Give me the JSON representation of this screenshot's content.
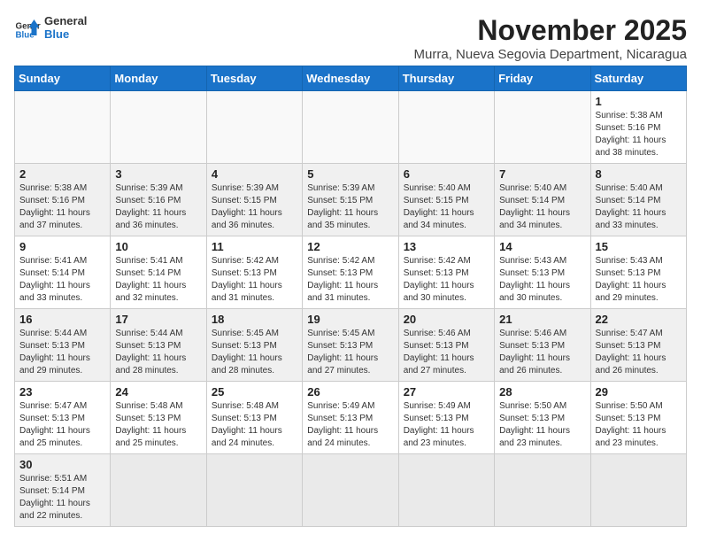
{
  "header": {
    "logo_line1": "General",
    "logo_line2": "Blue",
    "month_title": "November 2025",
    "subtitle": "Murra, Nueva Segovia Department, Nicaragua"
  },
  "weekdays": [
    "Sunday",
    "Monday",
    "Tuesday",
    "Wednesday",
    "Thursday",
    "Friday",
    "Saturday"
  ],
  "weeks": [
    [
      {
        "day": "",
        "info": ""
      },
      {
        "day": "",
        "info": ""
      },
      {
        "day": "",
        "info": ""
      },
      {
        "day": "",
        "info": ""
      },
      {
        "day": "",
        "info": ""
      },
      {
        "day": "",
        "info": ""
      },
      {
        "day": "1",
        "info": "Sunrise: 5:38 AM\nSunset: 5:16 PM\nDaylight: 11 hours and 38 minutes."
      }
    ],
    [
      {
        "day": "2",
        "info": "Sunrise: 5:38 AM\nSunset: 5:16 PM\nDaylight: 11 hours and 37 minutes."
      },
      {
        "day": "3",
        "info": "Sunrise: 5:39 AM\nSunset: 5:16 PM\nDaylight: 11 hours and 36 minutes."
      },
      {
        "day": "4",
        "info": "Sunrise: 5:39 AM\nSunset: 5:15 PM\nDaylight: 11 hours and 36 minutes."
      },
      {
        "day": "5",
        "info": "Sunrise: 5:39 AM\nSunset: 5:15 PM\nDaylight: 11 hours and 35 minutes."
      },
      {
        "day": "6",
        "info": "Sunrise: 5:40 AM\nSunset: 5:15 PM\nDaylight: 11 hours and 34 minutes."
      },
      {
        "day": "7",
        "info": "Sunrise: 5:40 AM\nSunset: 5:14 PM\nDaylight: 11 hours and 34 minutes."
      },
      {
        "day": "8",
        "info": "Sunrise: 5:40 AM\nSunset: 5:14 PM\nDaylight: 11 hours and 33 minutes."
      }
    ],
    [
      {
        "day": "9",
        "info": "Sunrise: 5:41 AM\nSunset: 5:14 PM\nDaylight: 11 hours and 33 minutes."
      },
      {
        "day": "10",
        "info": "Sunrise: 5:41 AM\nSunset: 5:14 PM\nDaylight: 11 hours and 32 minutes."
      },
      {
        "day": "11",
        "info": "Sunrise: 5:42 AM\nSunset: 5:13 PM\nDaylight: 11 hours and 31 minutes."
      },
      {
        "day": "12",
        "info": "Sunrise: 5:42 AM\nSunset: 5:13 PM\nDaylight: 11 hours and 31 minutes."
      },
      {
        "day": "13",
        "info": "Sunrise: 5:42 AM\nSunset: 5:13 PM\nDaylight: 11 hours and 30 minutes."
      },
      {
        "day": "14",
        "info": "Sunrise: 5:43 AM\nSunset: 5:13 PM\nDaylight: 11 hours and 30 minutes."
      },
      {
        "day": "15",
        "info": "Sunrise: 5:43 AM\nSunset: 5:13 PM\nDaylight: 11 hours and 29 minutes."
      }
    ],
    [
      {
        "day": "16",
        "info": "Sunrise: 5:44 AM\nSunset: 5:13 PM\nDaylight: 11 hours and 29 minutes."
      },
      {
        "day": "17",
        "info": "Sunrise: 5:44 AM\nSunset: 5:13 PM\nDaylight: 11 hours and 28 minutes."
      },
      {
        "day": "18",
        "info": "Sunrise: 5:45 AM\nSunset: 5:13 PM\nDaylight: 11 hours and 28 minutes."
      },
      {
        "day": "19",
        "info": "Sunrise: 5:45 AM\nSunset: 5:13 PM\nDaylight: 11 hours and 27 minutes."
      },
      {
        "day": "20",
        "info": "Sunrise: 5:46 AM\nSunset: 5:13 PM\nDaylight: 11 hours and 27 minutes."
      },
      {
        "day": "21",
        "info": "Sunrise: 5:46 AM\nSunset: 5:13 PM\nDaylight: 11 hours and 26 minutes."
      },
      {
        "day": "22",
        "info": "Sunrise: 5:47 AM\nSunset: 5:13 PM\nDaylight: 11 hours and 26 minutes."
      }
    ],
    [
      {
        "day": "23",
        "info": "Sunrise: 5:47 AM\nSunset: 5:13 PM\nDaylight: 11 hours and 25 minutes."
      },
      {
        "day": "24",
        "info": "Sunrise: 5:48 AM\nSunset: 5:13 PM\nDaylight: 11 hours and 25 minutes."
      },
      {
        "day": "25",
        "info": "Sunrise: 5:48 AM\nSunset: 5:13 PM\nDaylight: 11 hours and 24 minutes."
      },
      {
        "day": "26",
        "info": "Sunrise: 5:49 AM\nSunset: 5:13 PM\nDaylight: 11 hours and 24 minutes."
      },
      {
        "day": "27",
        "info": "Sunrise: 5:49 AM\nSunset: 5:13 PM\nDaylight: 11 hours and 23 minutes."
      },
      {
        "day": "28",
        "info": "Sunrise: 5:50 AM\nSunset: 5:13 PM\nDaylight: 11 hours and 23 minutes."
      },
      {
        "day": "29",
        "info": "Sunrise: 5:50 AM\nSunset: 5:13 PM\nDaylight: 11 hours and 23 minutes."
      }
    ],
    [
      {
        "day": "30",
        "info": "Sunrise: 5:51 AM\nSunset: 5:14 PM\nDaylight: 11 hours and 22 minutes."
      },
      {
        "day": "",
        "info": ""
      },
      {
        "day": "",
        "info": ""
      },
      {
        "day": "",
        "info": ""
      },
      {
        "day": "",
        "info": ""
      },
      {
        "day": "",
        "info": ""
      },
      {
        "day": "",
        "info": ""
      }
    ]
  ]
}
